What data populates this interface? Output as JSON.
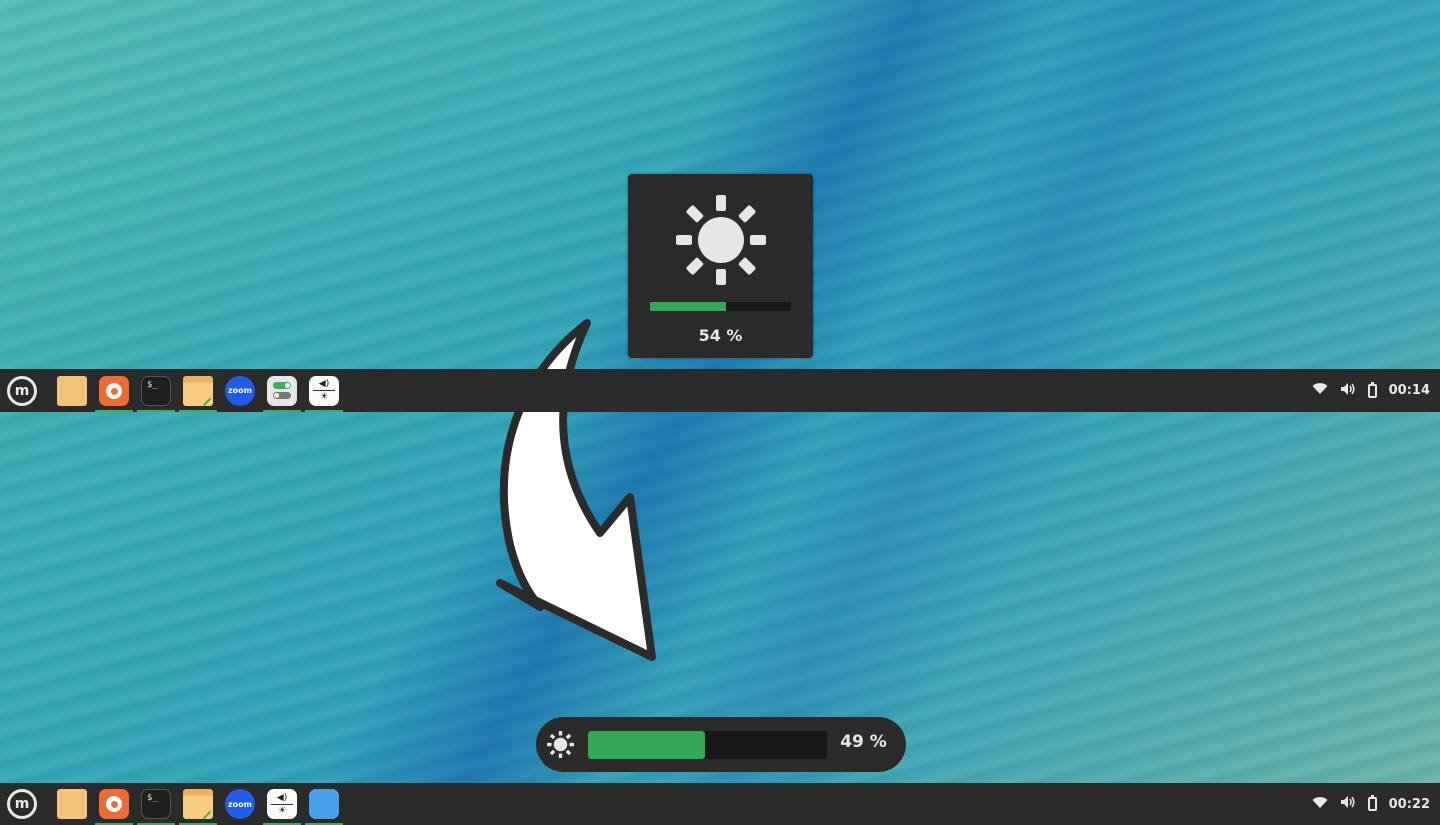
{
  "panels": {
    "top": {
      "launchers": [
        {
          "name": "files",
          "running": false
        },
        {
          "name": "firefox",
          "running": true
        },
        {
          "name": "terminal",
          "running": true
        },
        {
          "name": "file-manager",
          "running": true
        },
        {
          "name": "zoom",
          "running": false
        },
        {
          "name": "settings-toggles",
          "running": true
        },
        {
          "name": "sound-brightness",
          "running": true
        }
      ],
      "terminal_label": "$_",
      "zoom_label": "zoom",
      "clock": "00:14"
    },
    "bottom": {
      "launchers": [
        {
          "name": "files",
          "running": false
        },
        {
          "name": "firefox",
          "running": true
        },
        {
          "name": "terminal",
          "running": true
        },
        {
          "name": "file-manager",
          "running": true
        },
        {
          "name": "zoom",
          "running": false
        },
        {
          "name": "sound-brightness",
          "running": true
        },
        {
          "name": "workspace-switcher",
          "running": true
        }
      ],
      "terminal_label": "$_",
      "zoom_label": "zoom",
      "clock": "00:22"
    },
    "menu_glyph": "m",
    "tray_icons": [
      "wifi-icon",
      "volume-icon",
      "battery-icon"
    ]
  },
  "osd_old": {
    "icon": "brightness-icon",
    "level_percent": 54,
    "label": "54 %"
  },
  "osd_new": {
    "icon": "brightness-icon",
    "level_percent": 49,
    "label": "49 %"
  },
  "colors": {
    "accent_green": "#34a853",
    "panel_bg": "#2b2b2b"
  },
  "icons": {
    "volume": "🔊︎",
    "wifi": "◠",
    "sound_glyph": "◀)",
    "bright_glyph": "☀"
  }
}
